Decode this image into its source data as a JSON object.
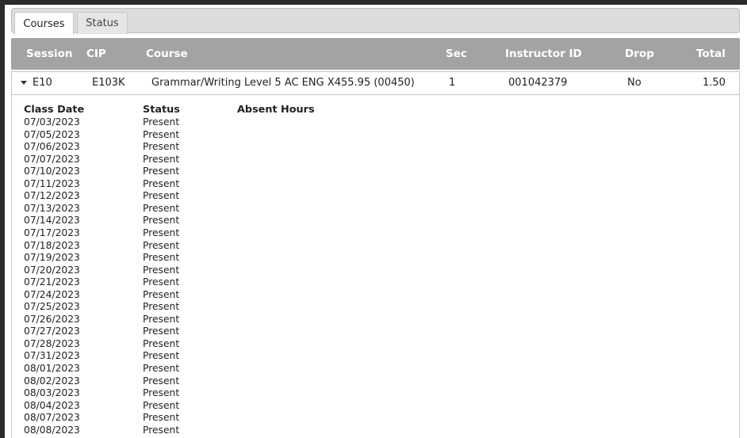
{
  "tabs": [
    {
      "label": "Courses",
      "active": true
    },
    {
      "label": "Status",
      "active": false
    }
  ],
  "table": {
    "headers": {
      "session": "Session",
      "cip": "CIP",
      "course": "Course",
      "sec": "Sec",
      "instructor_id": "Instructor ID",
      "drop": "Drop",
      "total": "Total"
    },
    "course_row": {
      "expanded": true,
      "session": "E10",
      "cip": "E103K",
      "course": "Grammar/Writing Level 5 AC ENG X455.95 (00450)",
      "sec": "1",
      "instructor_id": "001042379",
      "drop": "No",
      "total": "1.50"
    }
  },
  "attendance": {
    "headers": {
      "class_date": "Class Date",
      "status": "Status",
      "absent_hours": "Absent Hours"
    },
    "rows": [
      {
        "date": "07/03/2023",
        "status": "Present"
      },
      {
        "date": "07/05/2023",
        "status": "Present"
      },
      {
        "date": "07/06/2023",
        "status": "Present"
      },
      {
        "date": "07/07/2023",
        "status": "Present"
      },
      {
        "date": "07/10/2023",
        "status": "Present"
      },
      {
        "date": "07/11/2023",
        "status": "Present"
      },
      {
        "date": "07/12/2023",
        "status": "Present"
      },
      {
        "date": "07/13/2023",
        "status": "Present"
      },
      {
        "date": "07/14/2023",
        "status": "Present"
      },
      {
        "date": "07/17/2023",
        "status": "Present"
      },
      {
        "date": "07/18/2023",
        "status": "Present"
      },
      {
        "date": "07/19/2023",
        "status": "Present"
      },
      {
        "date": "07/20/2023",
        "status": "Present"
      },
      {
        "date": "07/21/2023",
        "status": "Present"
      },
      {
        "date": "07/24/2023",
        "status": "Present"
      },
      {
        "date": "07/25/2023",
        "status": "Present"
      },
      {
        "date": "07/26/2023",
        "status": "Present"
      },
      {
        "date": "07/27/2023",
        "status": "Present"
      },
      {
        "date": "07/28/2023",
        "status": "Present"
      },
      {
        "date": "07/31/2023",
        "status": "Present"
      },
      {
        "date": "08/01/2023",
        "status": "Present"
      },
      {
        "date": "08/02/2023",
        "status": "Present"
      },
      {
        "date": "08/03/2023",
        "status": "Present"
      },
      {
        "date": "08/04/2023",
        "status": "Present"
      },
      {
        "date": "08/07/2023",
        "status": "Present"
      },
      {
        "date": "08/08/2023",
        "status": "Present"
      }
    ]
  },
  "colors": {
    "header_bg": "#a3a3a3",
    "header_text": "#ffffff",
    "tabbar_bg": "#dcdcdc",
    "frame_bg": "#2b2b2b"
  },
  "icons": {
    "expand_toggle": "caret-down-icon"
  }
}
